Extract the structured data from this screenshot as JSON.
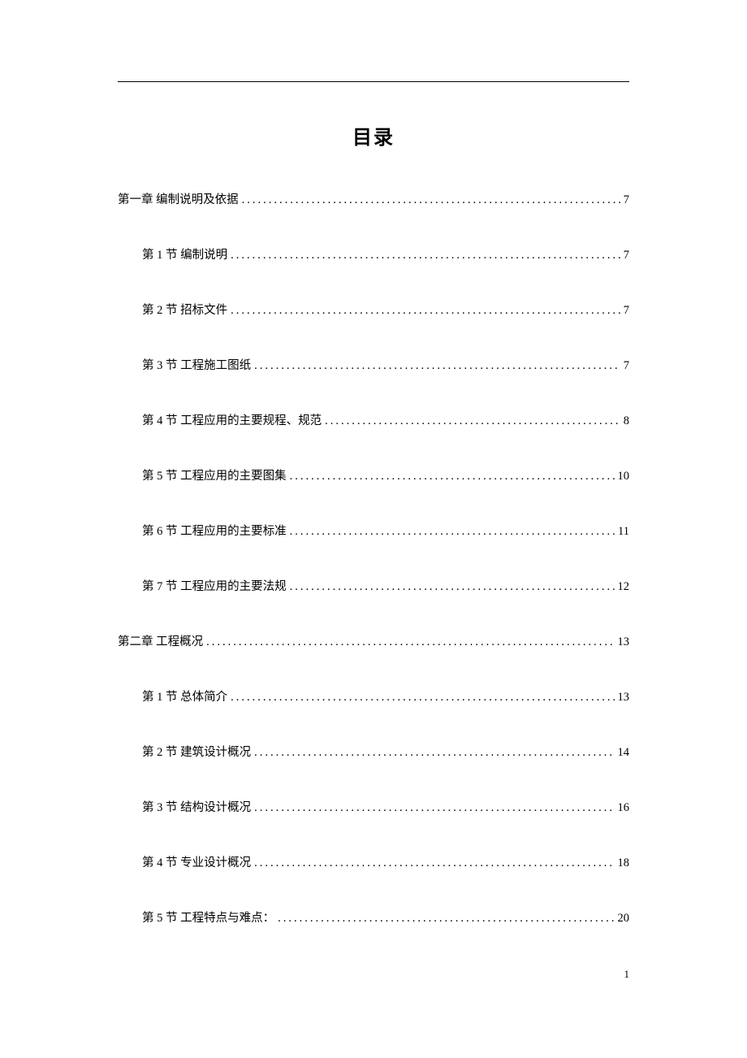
{
  "title": "目录",
  "toc": [
    {
      "level": 1,
      "label": "第一章 编制说明及依据",
      "page": "7"
    },
    {
      "level": 2,
      "label": "第 1 节 编制说明",
      "page": "7"
    },
    {
      "level": 2,
      "label": "第 2 节 招标文件",
      "page": "7"
    },
    {
      "level": 2,
      "label": "第 3 节 工程施工图纸",
      "page": "7"
    },
    {
      "level": 2,
      "label": "第 4 节 工程应用的主要规程、规范",
      "page": "8"
    },
    {
      "level": 2,
      "label": "第 5 节 工程应用的主要图集",
      "page": "10"
    },
    {
      "level": 2,
      "label": "第 6 节 工程应用的主要标准",
      "page": "11"
    },
    {
      "level": 2,
      "label": "第 7 节 工程应用的主要法规",
      "page": "12"
    },
    {
      "level": 1,
      "label": "第二章 工程概况",
      "page": "13"
    },
    {
      "level": 2,
      "label": "第 1 节 总体简介",
      "page": "13"
    },
    {
      "level": 2,
      "label": "第 2 节 建筑设计概况",
      "page": "14"
    },
    {
      "level": 2,
      "label": "第 3 节 结构设计概况",
      "page": "16"
    },
    {
      "level": 2,
      "label": "第 4 节 专业设计概况",
      "page": "18"
    },
    {
      "level": 2,
      "label": "第 5 节 工程特点与难点：",
      "page": "20"
    }
  ],
  "pageNumber": "1"
}
